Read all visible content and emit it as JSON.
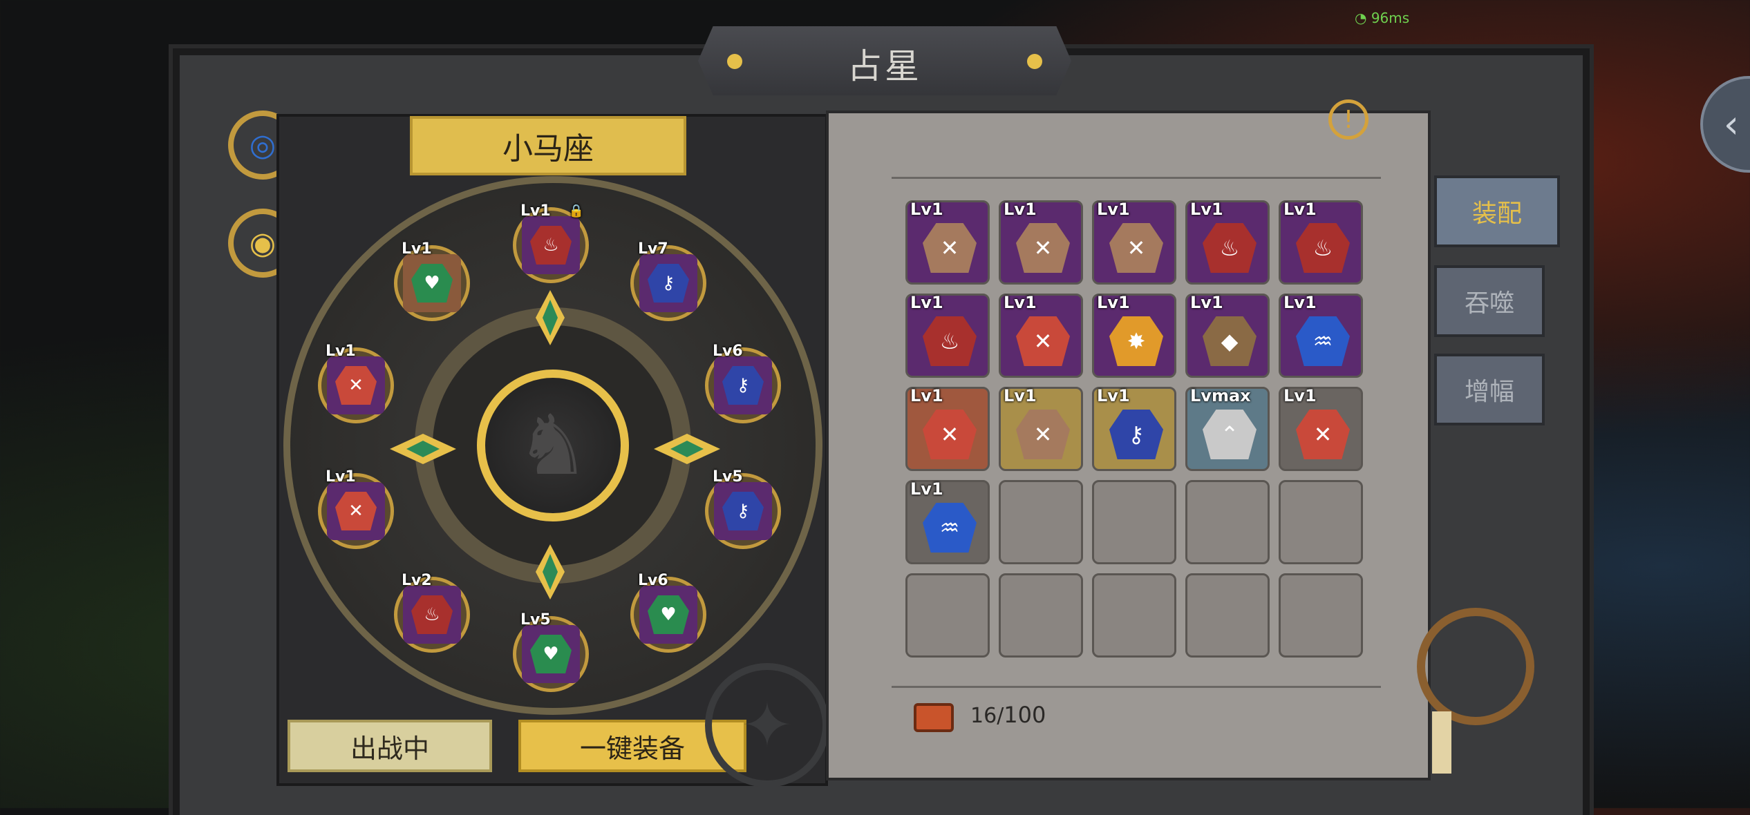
{
  "header": {
    "title": "占星",
    "ping": "96ms"
  },
  "constellation": {
    "name": "小马座",
    "center_icon": "horse-head-icon"
  },
  "wheel_slots": [
    {
      "lv": "Lv1",
      "color": "#a8302d",
      "bg": "#5b2a6e",
      "icon": "flame-icon",
      "locked": true
    },
    {
      "lv": "Lv7",
      "color": "#2f45a8",
      "bg": "#5b2a6e",
      "icon": "key-icon"
    },
    {
      "lv": "Lv6",
      "color": "#2f45a8",
      "bg": "#5b2a6e",
      "icon": "key-icon"
    },
    {
      "lv": "Lv5",
      "color": "#2f45a8",
      "bg": "#5b2a6e",
      "icon": "key-icon"
    },
    {
      "lv": "Lv6",
      "color": "#2a8c4f",
      "bg": "#5b2a6e",
      "icon": "heart-icon"
    },
    {
      "lv": "Lv5",
      "color": "#2a8c4f",
      "bg": "#5b2a6e",
      "icon": "heart-icon"
    },
    {
      "lv": "Lv2",
      "color": "#a8302d",
      "bg": "#5b2a6e",
      "icon": "flame-icon"
    },
    {
      "lv": "Lv1",
      "color": "#c9493a",
      "bg": "#5b2a6e",
      "icon": "sword-icon"
    },
    {
      "lv": "Lv1",
      "color": "#c9493a",
      "bg": "#5b2a6e",
      "icon": "sword-icon"
    },
    {
      "lv": "Lv1",
      "color": "#2a8c4f",
      "bg": "#8a5a3c",
      "icon": "heart-icon"
    }
  ],
  "side_buttons": [
    {
      "name": "spiral-button",
      "icon": "spiral-icon",
      "color": "#2f6ed0"
    },
    {
      "name": "eye-button",
      "icon": "eye-icon",
      "color": "#3c8a4a"
    }
  ],
  "buttons": {
    "deployed": "出战中",
    "equip_all": "一键装备"
  },
  "tabs": {
    "equip": "装配",
    "devour": "吞噬",
    "amplify": "增幅"
  },
  "inventory": {
    "items": [
      {
        "lv": "Lv1",
        "color": "#a57a5e",
        "bg": "#5b2a6e",
        "icon": "sword-icon"
      },
      {
        "lv": "Lv1",
        "color": "#a57a5e",
        "bg": "#5b2a6e",
        "icon": "sword-icon"
      },
      {
        "lv": "Lv1",
        "color": "#a57a5e",
        "bg": "#5b2a6e",
        "icon": "sword-icon"
      },
      {
        "lv": "Lv1",
        "color": "#a8302d",
        "bg": "#5b2a6e",
        "icon": "flame-icon"
      },
      {
        "lv": "Lv1",
        "color": "#a8302d",
        "bg": "#5b2a6e",
        "icon": "flame-icon"
      },
      {
        "lv": "Lv1",
        "color": "#a8302d",
        "bg": "#5b2a6e",
        "icon": "flame-icon"
      },
      {
        "lv": "Lv1",
        "color": "#c9493a",
        "bg": "#5b2a6e",
        "icon": "sword-icon"
      },
      {
        "lv": "Lv1",
        "color": "#e19a2a",
        "bg": "#5b2a6e",
        "icon": "spark-icon"
      },
      {
        "lv": "Lv1",
        "color": "#8a6a45",
        "bg": "#5b2a6e",
        "icon": "shield-icon"
      },
      {
        "lv": "Lv1",
        "color": "#2a5ac8",
        "bg": "#5b2a6e",
        "icon": "water-icon"
      },
      {
        "lv": "Lv1",
        "color": "#c9493a",
        "bg": "#a0583e",
        "icon": "sword-icon"
      },
      {
        "lv": "Lv1",
        "color": "#a57a5e",
        "bg": "#a98f4a",
        "icon": "sword-icon"
      },
      {
        "lv": "Lv1",
        "color": "#2f45a8",
        "bg": "#a98f4a",
        "icon": "key-icon"
      },
      {
        "lv": "Lvmax",
        "color": "#c9c9c9",
        "bg": "#5e7a88",
        "icon": "chevron-up-icon"
      },
      {
        "lv": "Lv1",
        "color": "#c9493a",
        "bg": "#6a6561",
        "icon": "sword-icon"
      },
      {
        "lv": "Lv1",
        "color": "#2a5ac8",
        "bg": "#6a6561",
        "icon": "water-icon"
      }
    ],
    "count": "16",
    "capacity": "100"
  }
}
